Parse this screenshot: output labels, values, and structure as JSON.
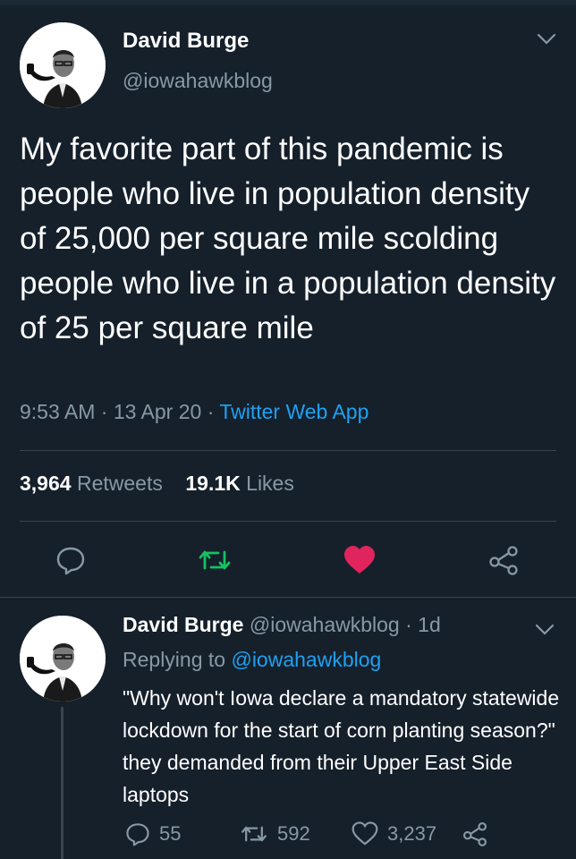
{
  "tweet": {
    "author_name": "David Burge",
    "author_handle": "@iowahawkblog",
    "text": "My favorite part of this pandemic is people who live in population density of 25,000 per square mile scolding people who live in a population density of 25 per square mile",
    "time": "9:53 AM",
    "date": "13 Apr 20",
    "source": "Twitter Web App",
    "retweet_count": "3,964",
    "retweet_label": "Retweets",
    "like_count": "19.1K",
    "like_label": "Likes",
    "liked": true
  },
  "reply": {
    "author_name": "David Burge",
    "author_handle": "@iowahawkblog",
    "age": "1d",
    "replying_to_label": "Replying to",
    "replying_to_handle": "@iowahawkblog",
    "text": "\"Why won't Iowa declare a mandatory statewide lockdown for the start of corn planting season?\" they demanded from their Upper East Side laptops",
    "reply_count": "55",
    "retweet_count": "592",
    "like_count": "3,237"
  },
  "colors": {
    "background": "#15202b",
    "secondary_text": "#8899a6",
    "link": "#1da1f2",
    "like_active": "#e0245e",
    "retweet_active": "#17bf63"
  }
}
